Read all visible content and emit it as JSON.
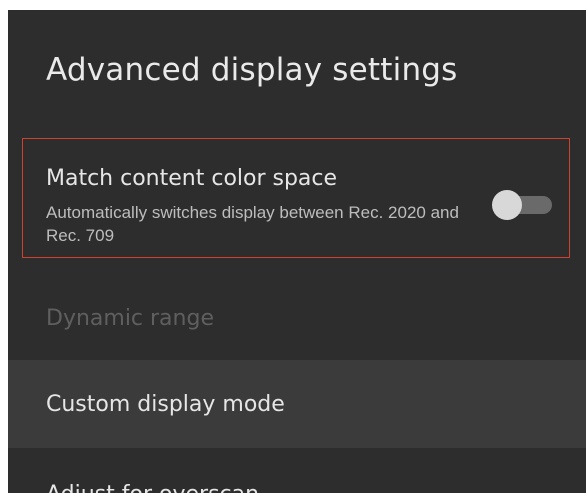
{
  "header": {
    "title": "Advanced display settings"
  },
  "settings": [
    {
      "title": "Match content color space",
      "description": "Automatically switches display between Rec. 2020 and Rec. 709",
      "toggle_on": false
    },
    {
      "title": "Dynamic range",
      "disabled": true
    },
    {
      "title": "Custom display mode"
    },
    {
      "title": "Adjust for overscan"
    }
  ],
  "colors": {
    "background": "#2d2d2d",
    "highlight_row": "#3b3b3b",
    "focus_outline": "#c9432e",
    "primary_text": "#e6e6e6",
    "secondary_text": "#bdbdbd",
    "disabled_text": "#5f5f5f"
  }
}
